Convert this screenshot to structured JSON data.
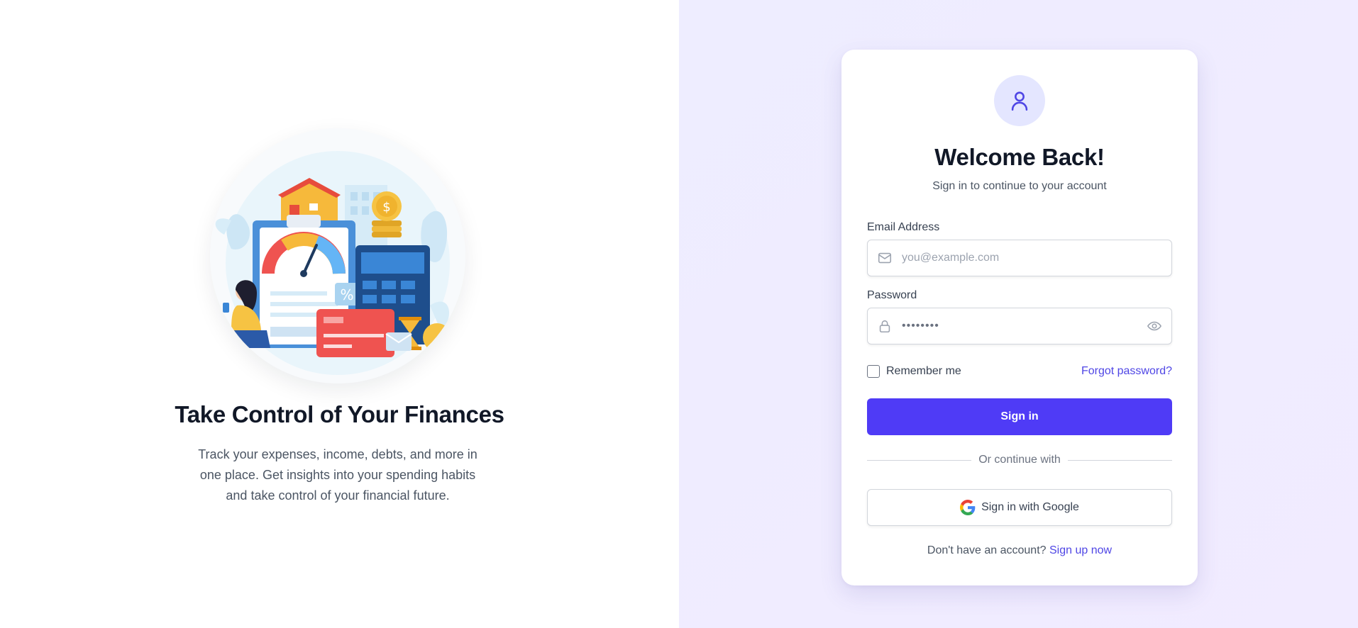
{
  "hero": {
    "title": "Take Control of Your Finances",
    "text": "Track your expenses, income, debts, and more in one place. Get insights into your spending habits and take control of your financial future."
  },
  "auth": {
    "title": "Welcome Back!",
    "subtitle": "Sign in to continue to your account",
    "email": {
      "label": "Email Address",
      "placeholder": "you@example.com",
      "icon": "mail-icon"
    },
    "password": {
      "label": "Password",
      "value": "••••••••",
      "icon": "lock-icon",
      "toggle_icon": "eye-icon"
    },
    "remember_label": "Remember me",
    "forgot_label": "Forgot password?",
    "signin_label": "Sign in",
    "divider_label": "Or continue with",
    "google_label": "Sign in with Google",
    "signup_prompt": "Don't have an account?",
    "signup_link": "Sign up now"
  },
  "colors": {
    "accent": "#4f3bf6",
    "link": "#4f46e5",
    "panel_bg": "#eeedff",
    "avatar_bg": "#e4e6ff"
  }
}
